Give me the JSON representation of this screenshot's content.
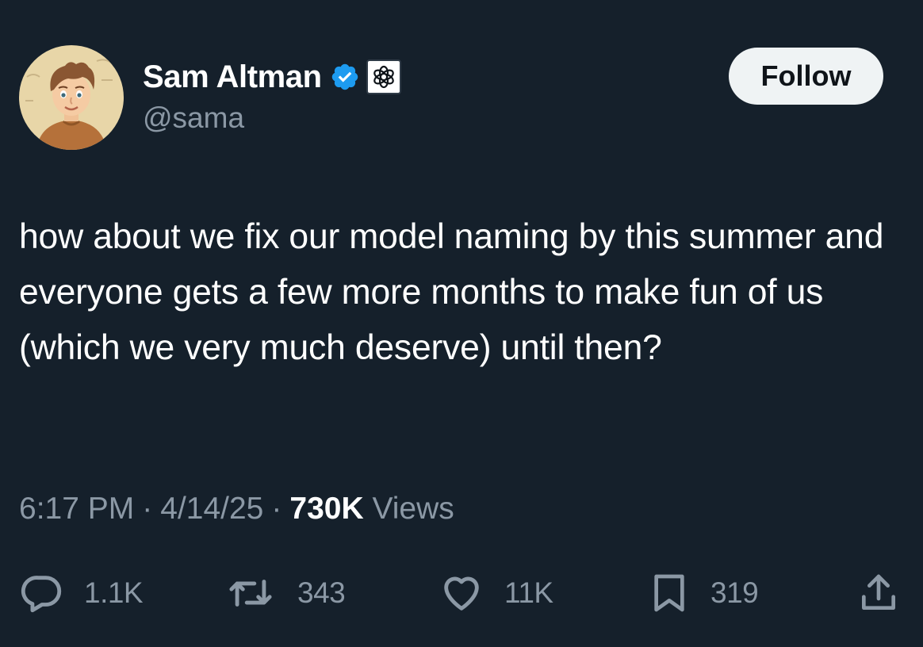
{
  "author": {
    "display_name": "Sam Altman",
    "handle": "@sama",
    "verified_badge_icon": "verified-check-icon",
    "affiliate_badge_icon": "openai-logo-icon",
    "verified_color": "#1d9bf0"
  },
  "follow_button": {
    "label": "Follow"
  },
  "tweet": {
    "text": "how about we fix our model naming by this summer and everyone gets a few more months to make fun of us (which we very much deserve) until then?"
  },
  "meta": {
    "time": "6:17 PM",
    "separator": "·",
    "date": "4/14/25",
    "views_count": "730K",
    "views_label": "Views"
  },
  "actions": {
    "reply": {
      "icon": "reply-icon",
      "count": "1.1K"
    },
    "repost": {
      "icon": "repost-icon",
      "count": "343"
    },
    "like": {
      "icon": "heart-icon",
      "count": "11K"
    },
    "bookmark": {
      "icon": "bookmark-icon",
      "count": "319"
    },
    "share": {
      "icon": "share-icon"
    }
  },
  "theme": {
    "background": "#15202b",
    "primary_text": "#ffffff",
    "secondary_text": "#8b98a5",
    "button_bg": "#eff3f4"
  }
}
